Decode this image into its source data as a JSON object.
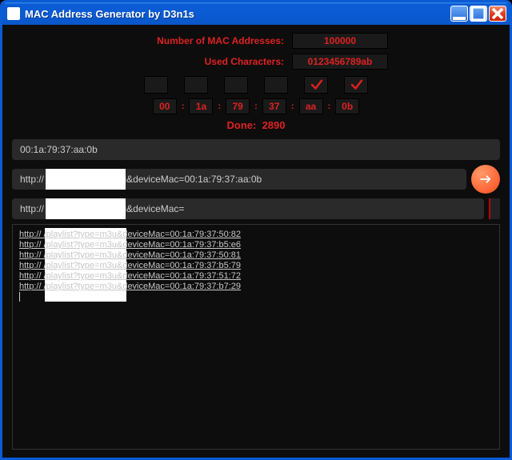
{
  "titlebar": {
    "title": "MAC Address Generator by D3n1s"
  },
  "config": {
    "num_label": "Number of MAC Addresses:",
    "num_value": "100000",
    "chars_label": "Used Characters:",
    "chars_value": "0123456789ab"
  },
  "locks": [
    false,
    false,
    false,
    false,
    true,
    true
  ],
  "mac_segments": [
    "00",
    "1a",
    "79",
    "37",
    "aa",
    "0b"
  ],
  "done_label": "Done:",
  "done_value": "2890",
  "current_mac": "00:1a:79:37:aa:0b",
  "url_full": "http://               /playlist?type=m3u&deviceMac=00:1a:79:37:aa:0b",
  "url_template": "http://               /playlist?type=m3u&deviceMac=",
  "output_lines": [
    "http://               /playlist?type=m3u&deviceMac=00:1a:79:37:50:82",
    "http://               /playlist?type=m3u&deviceMac=00:1a:79:37:b5:e6",
    "http://               /playlist?type=m3u&deviceMac=00:1a:79:37:50:81",
    "http://               /playlist?type=m3u&deviceMac=00:1a:79:37:b5:79",
    "http://               /playlist?type=m3u&deviceMac=00:1a:79:37:51:72",
    "http://               /playlist?type=m3u&deviceMac=00:1a:79:37:b7:29"
  ],
  "colors": {
    "accent_red": "#d22222",
    "accent_orange": "#ff6a3a"
  }
}
